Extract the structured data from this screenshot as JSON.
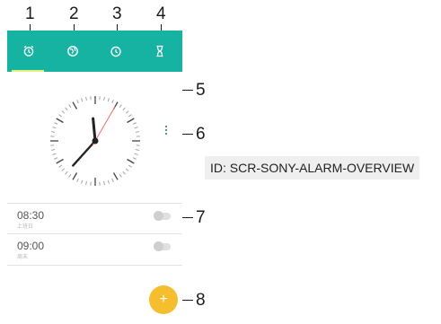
{
  "callouts": {
    "n1": "1",
    "n2": "2",
    "n3": "3",
    "n4": "4",
    "n5": "5",
    "n6": "6",
    "n7": "7",
    "n8": "8"
  },
  "tabs": [
    {
      "icon": "alarm-icon"
    },
    {
      "icon": "globe-icon"
    },
    {
      "icon": "stopwatch-icon"
    },
    {
      "icon": "hourglass-icon"
    }
  ],
  "alarms": [
    {
      "time": "08:30",
      "label": "上班日",
      "enabled": false
    },
    {
      "time": "09:00",
      "label": "周末",
      "enabled": false
    }
  ],
  "add_button": {
    "label": "+"
  },
  "id_label": "ID: SCR-SONY-ALARM-OVERVIEW",
  "colors": {
    "tabbar": "#16b3a3",
    "tab_indicator": "#e7f27a",
    "fab": "#f4be2e",
    "second_hand": "#f26d6d"
  },
  "clock": {
    "hour": 1,
    "minute": 37,
    "second": 5
  }
}
